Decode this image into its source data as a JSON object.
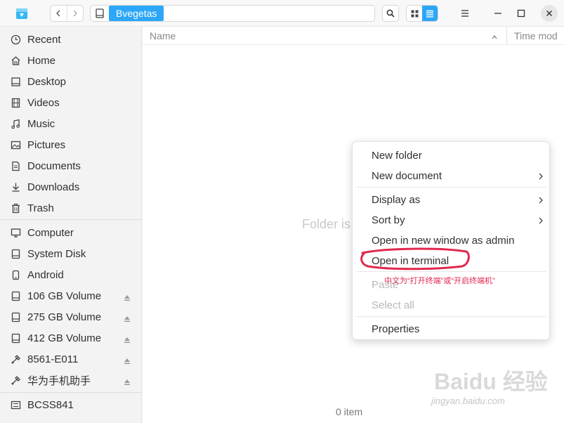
{
  "titlebar": {
    "path_crumb": "Bvegetas"
  },
  "sidebar": {
    "items": [
      {
        "label": "Recent",
        "icon": "clock-icon"
      },
      {
        "label": "Home",
        "icon": "home-icon"
      },
      {
        "label": "Desktop",
        "icon": "desktop-icon"
      },
      {
        "label": "Videos",
        "icon": "film-icon"
      },
      {
        "label": "Music",
        "icon": "music-note-icon"
      },
      {
        "label": "Pictures",
        "icon": "picture-icon"
      },
      {
        "label": "Documents",
        "icon": "document-icon"
      },
      {
        "label": "Downloads",
        "icon": "download-icon"
      },
      {
        "label": "Trash",
        "icon": "trash-icon"
      }
    ],
    "devices": [
      {
        "label": "Computer",
        "icon": "monitor-icon",
        "eject": false
      },
      {
        "label": "System Disk",
        "icon": "disk-icon",
        "eject": false
      },
      {
        "label": "Android",
        "icon": "phone-icon",
        "eject": false
      },
      {
        "label": "106 GB Volume",
        "icon": "disk-icon",
        "eject": true
      },
      {
        "label": "275 GB Volume",
        "icon": "disk-icon",
        "eject": true
      },
      {
        "label": "412 GB Volume",
        "icon": "disk-icon",
        "eject": true
      },
      {
        "label": "8561-E011",
        "icon": "usb-icon",
        "eject": true
      },
      {
        "label": "华为手机助手",
        "icon": "usb-icon",
        "eject": true
      }
    ],
    "network": [
      {
        "label": "BCSS841",
        "icon": "drive-icon"
      }
    ]
  },
  "main": {
    "columns": {
      "name": "Name",
      "time": "Time mod"
    },
    "empty_text": "Folder is",
    "status": "0 item"
  },
  "context_menu": {
    "items": [
      {
        "label": "New folder",
        "enabled": true,
        "submenu": false
      },
      {
        "label": "New document",
        "enabled": true,
        "submenu": true
      },
      {
        "label": "Display as",
        "enabled": true,
        "submenu": true
      },
      {
        "label": "Sort by",
        "enabled": true,
        "submenu": true
      },
      {
        "label": "Open in new window as admin",
        "enabled": true,
        "submenu": false
      },
      {
        "label": "Open in terminal",
        "enabled": true,
        "submenu": false
      },
      {
        "label": "Paste",
        "enabled": false,
        "submenu": false
      },
      {
        "label": "Select all",
        "enabled": false,
        "submenu": false
      },
      {
        "label": "Properties",
        "enabled": true,
        "submenu": false
      }
    ]
  },
  "annotation": {
    "note": "中文为“打开终端”或“开启终端机”",
    "color": "#e0284d"
  },
  "watermark": {
    "main": "Baidu 经验",
    "sub": "jingyan.baidu.com"
  },
  "colors": {
    "accent": "#2ca7f8",
    "sidebar_bg": "#f3f3f3",
    "main_bg": "#ffffff"
  }
}
